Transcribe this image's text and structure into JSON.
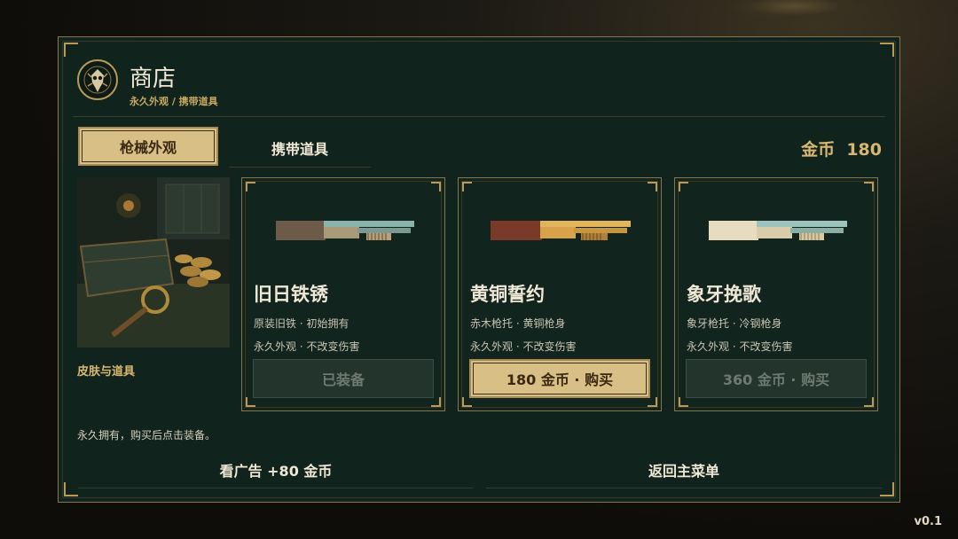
{
  "header": {
    "title": "商店",
    "breadcrumb": "永久外观 / 携带道具",
    "emblem_icon": "bird-skull-emblem-icon"
  },
  "tabs": [
    {
      "label": "枪械外观",
      "active": true
    },
    {
      "label": "携带道具",
      "active": false
    }
  ],
  "currency": {
    "label": "金币",
    "amount": "180"
  },
  "preview": {
    "label": "皮肤与道具"
  },
  "cards": [
    {
      "name": "旧日铁锈",
      "line1": "原装旧铁 · 初始拥有",
      "line2": "永久外观 · 不改变伤害",
      "button": "已装备",
      "button_state": "disabled",
      "stock_color": "#6e5a48",
      "body_color": "#a99a7a",
      "barrel_color": "#8ab3ac"
    },
    {
      "name": "黄铜誓约",
      "line1": "赤木枪托 · 黄铜枪身",
      "line2": "永久外观 · 不改变伤害",
      "button": "180 金币 · 购买",
      "button_state": "active",
      "stock_color": "#7a3a2a",
      "body_color": "#d8a24a",
      "barrel_color": "#e2b45c"
    },
    {
      "name": "象牙挽歌",
      "line1": "象牙枪托 · 冷钢枪身",
      "line2": "永久外观 · 不改变伤害",
      "button": "360 金币 · 购买",
      "button_state": "disabled",
      "stock_color": "#e8dcc0",
      "body_color": "#d8ccaa",
      "barrel_color": "#9cc4bc"
    }
  ],
  "note": "永久拥有，购买后点击装备。",
  "footer": {
    "ad_button": "看广告 +80 金币",
    "back_button": "返回主菜单"
  },
  "version": "v0.1"
}
